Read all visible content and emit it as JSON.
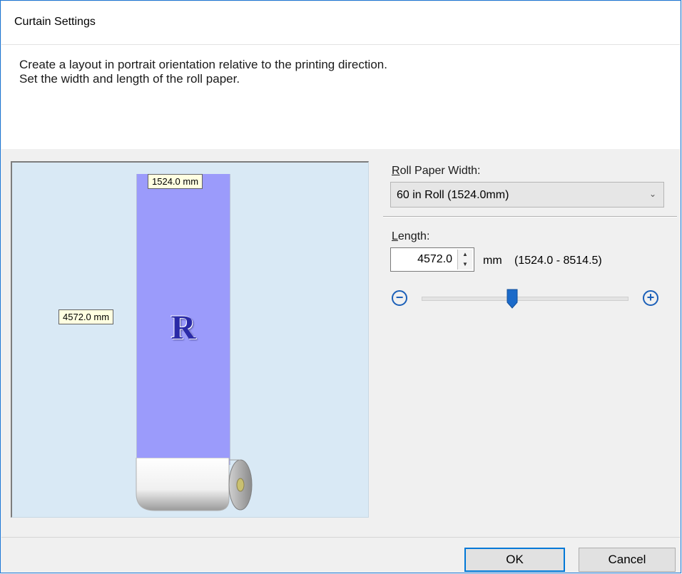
{
  "window": {
    "title": "Curtain Settings"
  },
  "instructions": {
    "line1": "Create a layout in portrait orientation relative to the printing direction.",
    "line2": "Set the width and length of the roll paper."
  },
  "preview": {
    "width_label": "1524.0 mm",
    "length_label": "4572.0 mm",
    "letter": "R",
    "paper_color": "#9b9bfb",
    "background_color": "#d9e9f5"
  },
  "roll_paper_width": {
    "label_accel": "R",
    "label_rest": "oll Paper Width:",
    "selected": "60 in Roll (1524.0mm)"
  },
  "length": {
    "label_accel": "L",
    "label_rest": "ength:",
    "value": "4572.0",
    "unit": "mm",
    "range": "(1524.0 - 8514.5)",
    "slider_fraction": 0.44
  },
  "buttons": {
    "ok": "OK",
    "cancel": "Cancel"
  },
  "colors": {
    "accent": "#0078d7",
    "slider_thumb": "#1b6ac9"
  }
}
